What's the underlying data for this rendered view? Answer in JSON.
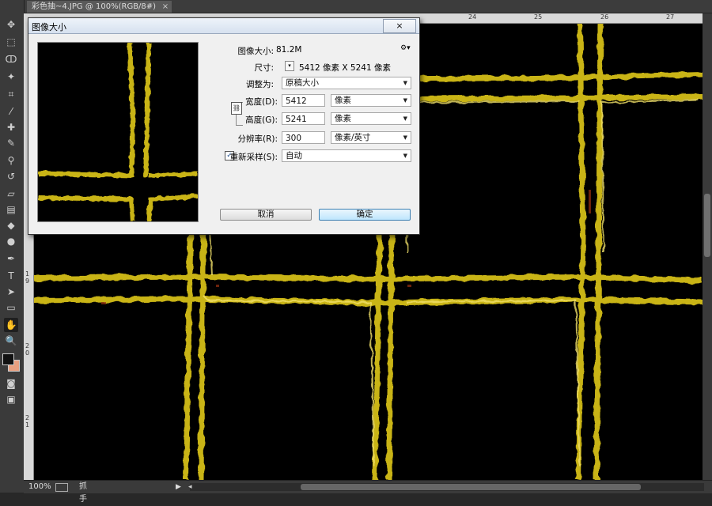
{
  "document": {
    "tab_title": "彩色抽~4.JPG @ 100%(RGB/8#)",
    "tab_close": "×"
  },
  "toolbar": {
    "tools": [
      {
        "name": "move-tool-icon",
        "glyph": "✥"
      },
      {
        "name": "marquee-tool-icon",
        "glyph": "⬚"
      },
      {
        "name": "lasso-tool-icon",
        "glyph": "ↀ"
      },
      {
        "name": "magic-wand-tool-icon",
        "glyph": "✦"
      },
      {
        "name": "crop-tool-icon",
        "glyph": "⌗"
      },
      {
        "name": "eyedropper-tool-icon",
        "glyph": "⁄"
      },
      {
        "name": "healing-brush-tool-icon",
        "glyph": "✚"
      },
      {
        "name": "brush-tool-icon",
        "glyph": "✎"
      },
      {
        "name": "clone-stamp-tool-icon",
        "glyph": "⚲"
      },
      {
        "name": "history-brush-tool-icon",
        "glyph": "↺"
      },
      {
        "name": "eraser-tool-icon",
        "glyph": "▱"
      },
      {
        "name": "gradient-tool-icon",
        "glyph": "▤"
      },
      {
        "name": "blur-tool-icon",
        "glyph": "◆"
      },
      {
        "name": "dodge-tool-icon",
        "glyph": "●"
      },
      {
        "name": "pen-tool-icon",
        "glyph": "✒"
      },
      {
        "name": "type-tool-icon",
        "glyph": "T"
      },
      {
        "name": "path-selection-tool-icon",
        "glyph": "➤"
      },
      {
        "name": "shape-tool-icon",
        "glyph": "▭"
      },
      {
        "name": "hand-tool-icon",
        "glyph": "✋"
      },
      {
        "name": "zoom-tool-icon",
        "glyph": "🔍"
      }
    ],
    "foreground_color": "#111111",
    "background_color": "#e8a080"
  },
  "rulers": {
    "top_labels": [
      "24",
      "25",
      "26",
      "27"
    ],
    "left_labels": [
      "1",
      "9",
      "2",
      "0",
      "2",
      "1"
    ]
  },
  "dialog": {
    "title": "图像大小",
    "close_glyph": "×",
    "image_size_label": "图像大小:",
    "image_size_value": "81.2M",
    "gear_icon": "⚙▾",
    "dimensions_label": "尺寸:",
    "dimensions_value": "5412 像素  X  5241 像素",
    "fit_to_label": "调整为:",
    "fit_to_value": "原稿大小",
    "width_label": "宽度(D):",
    "width_value": "5412",
    "width_unit": "像素",
    "height_label": "高度(G):",
    "height_value": "5241",
    "height_unit": "像素",
    "resolution_label": "分辨率(R):",
    "resolution_value": "300",
    "resolution_unit": "像素/英寸",
    "resample_label": "重新采样(S):",
    "resample_checked": true,
    "resample_value": "自动",
    "cancel_label": "取消",
    "ok_label": "确定"
  },
  "status": {
    "zoom": "100%",
    "tool_label": "抓手"
  },
  "colors": {
    "gold": "#d6c21a",
    "gold_dark": "#8a7a10",
    "ui_dark": "#3a3a3a",
    "dialog_bg": "#f0f0f0"
  }
}
